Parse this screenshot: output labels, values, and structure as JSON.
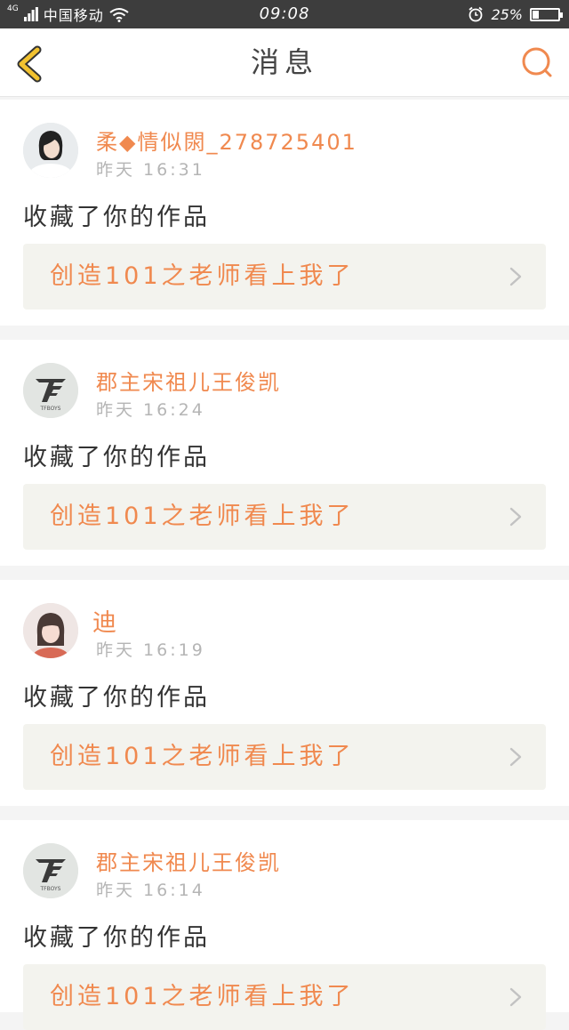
{
  "status_bar": {
    "network": "4G",
    "carrier": "中国移动",
    "time": "09:08",
    "battery_percent": "25%",
    "battery_level": 0.25
  },
  "header": {
    "title": "消息",
    "back_icon": "chevron-left-icon",
    "search_icon": "search-icon"
  },
  "colors": {
    "accent": "#f0894f",
    "back_icon": "#f2c230",
    "card_link_bg": "#f3f3ee",
    "separator": "#f4f4f4"
  },
  "notifications": [
    {
      "username": "柔◆情似閖_278725401",
      "time": "昨天 16:31",
      "action": "收藏了你的作品",
      "work_title": "创造101之老师看上我了",
      "avatar": "girl-portrait"
    },
    {
      "username": "郡主宋祖儿王俊凯",
      "time": "昨天 16:24",
      "action": "收藏了你的作品",
      "work_title": "创造101之老师看上我了",
      "avatar": "tfboys-logo",
      "avatar_caption": "TFBOYS"
    },
    {
      "username": "迪",
      "time": "昨天 16:19",
      "action": "收藏了你的作品",
      "work_title": "创造101之老师看上我了",
      "avatar": "girl-portrait"
    },
    {
      "username": "郡主宋祖儿王俊凯",
      "time": "昨天 16:14",
      "action": "收藏了你的作品",
      "work_title": "创造101之老师看上我了",
      "avatar": "tfboys-logo",
      "avatar_caption": "TFBOYS"
    }
  ]
}
